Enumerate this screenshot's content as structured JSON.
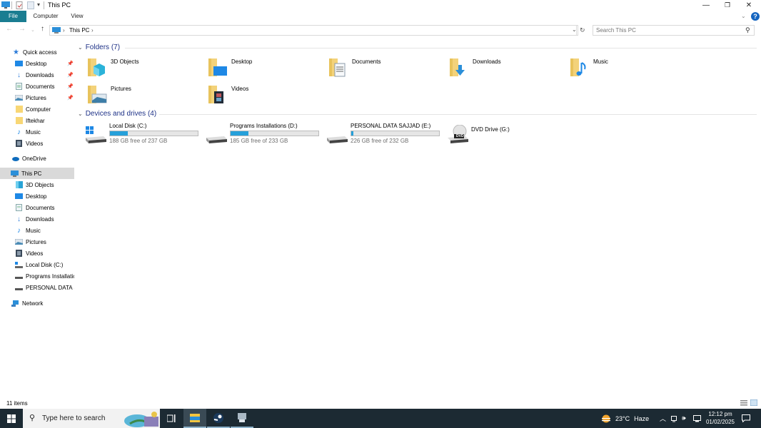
{
  "window": {
    "title": "This PC",
    "controls": {
      "minimize": "—",
      "restore": "❐",
      "close": "✕"
    }
  },
  "ribbon": {
    "tabs": [
      {
        "label": "File",
        "active": true
      },
      {
        "label": "Computer"
      },
      {
        "label": "View"
      }
    ]
  },
  "address": {
    "crumbs": [
      "This PC"
    ],
    "separator": "›"
  },
  "search": {
    "placeholder": "Search This PC"
  },
  "sidebar": {
    "quick_access": {
      "label": "Quick access",
      "items": [
        {
          "label": "Desktop",
          "icon": "desktop-icon",
          "pinned": true
        },
        {
          "label": "Downloads",
          "icon": "downloads-icon",
          "pinned": true
        },
        {
          "label": "Documents",
          "icon": "documents-icon",
          "pinned": true
        },
        {
          "label": "Pictures",
          "icon": "pictures-icon",
          "pinned": true
        },
        {
          "label": "Computer",
          "icon": "folder-icon"
        },
        {
          "label": "Iftekhar",
          "icon": "folder-icon"
        },
        {
          "label": "Music",
          "icon": "music-icon"
        },
        {
          "label": "Videos",
          "icon": "videos-icon"
        }
      ]
    },
    "onedrive": {
      "label": "OneDrive"
    },
    "this_pc": {
      "label": "This PC",
      "selected": true,
      "items": [
        {
          "label": "3D Objects",
          "icon": "3d-objects-icon"
        },
        {
          "label": "Desktop",
          "icon": "desktop-icon"
        },
        {
          "label": "Documents",
          "icon": "documents-icon"
        },
        {
          "label": "Downloads",
          "icon": "downloads-icon"
        },
        {
          "label": "Music",
          "icon": "music-icon"
        },
        {
          "label": "Pictures",
          "icon": "pictures-icon"
        },
        {
          "label": "Videos",
          "icon": "videos-icon"
        },
        {
          "label": "Local Disk (C:)",
          "icon": "local-disk-icon"
        },
        {
          "label": "Programs Installatic",
          "icon": "drive-icon"
        },
        {
          "label": "PERSONAL DATA SA",
          "icon": "drive-icon"
        }
      ]
    },
    "network": {
      "label": "Network"
    }
  },
  "content": {
    "folders_group": {
      "label": "Folders (7)",
      "items": [
        {
          "label": "3D Objects",
          "icon": "3d-objects-folder-icon"
        },
        {
          "label": "Desktop",
          "icon": "desktop-folder-icon"
        },
        {
          "label": "Documents",
          "icon": "documents-folder-icon"
        },
        {
          "label": "Downloads",
          "icon": "downloads-folder-icon"
        },
        {
          "label": "Music",
          "icon": "music-folder-icon"
        },
        {
          "label": "Pictures",
          "icon": "pictures-folder-icon"
        },
        {
          "label": "Videos",
          "icon": "videos-folder-icon"
        }
      ]
    },
    "drives_group": {
      "label": "Devices and drives (4)",
      "items": [
        {
          "label": "Local Disk (C:)",
          "free": "188 GB free of 237 GB",
          "used_fraction": 0.207,
          "icon": "windows-drive-icon"
        },
        {
          "label": "Programs Installations (D:)",
          "free": "185 GB free of 233 GB",
          "used_fraction": 0.206,
          "icon": "drive-icon"
        },
        {
          "label": "PERSONAL DATA SAJJAD (E:)",
          "free": "226 GB free of 232 GB",
          "used_fraction": 0.026,
          "icon": "drive-icon"
        },
        {
          "label": "DVD Drive (G:)",
          "icon": "dvd-drive-icon",
          "dvd_badge": "DVD"
        }
      ]
    }
  },
  "status": {
    "item_count": "11 items"
  },
  "taskbar": {
    "search_placeholder": "Type here to search",
    "weather": {
      "temp": "23°C",
      "condition": "Haze"
    },
    "clock": {
      "time": "12:12 pm",
      "date": "01/02/2025"
    }
  },
  "colors": {
    "file_tab": "#1a7d91",
    "accent": "#26a0da",
    "group_header": "#1e3287",
    "taskbar": "#1c2a33",
    "selected": "#d9d9d9"
  }
}
